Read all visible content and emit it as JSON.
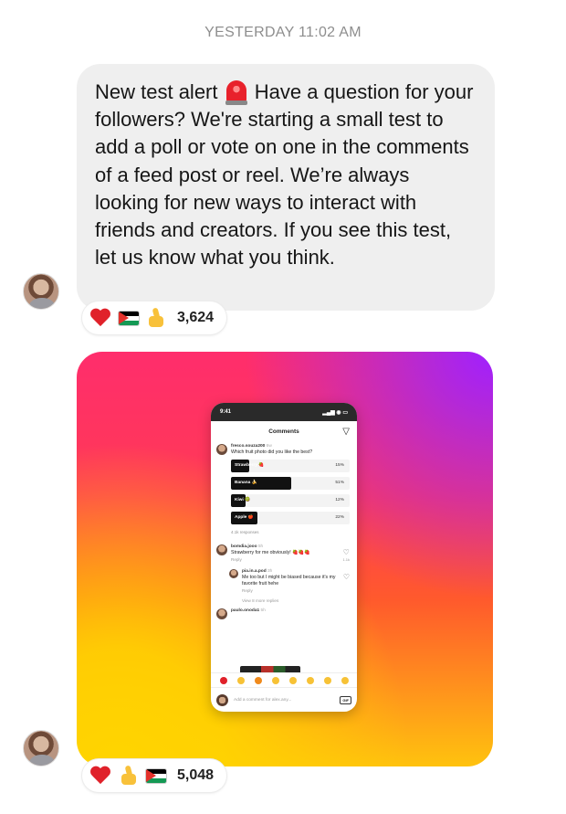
{
  "timestamp": "YESTERDAY 11:02 AM",
  "message": {
    "line1_before": "New test alert",
    "line1_after": "Have a question for",
    "rest": "your followers? We're starting a small test to add a poll or vote on one in the comments of a feed post or reel. We’re always looking for new ways to interact with friends and creators. If you see this test, let us know what you think."
  },
  "reactions": [
    {
      "icons": [
        "red-heart-icon",
        "palestine-flag-icon",
        "thumbs-up-icon"
      ],
      "count": "3,624"
    },
    {
      "icons": [
        "red-heart-icon",
        "thumbs-up-icon",
        "palestine-flag-icon"
      ],
      "count": "5,048"
    }
  ],
  "colors": {
    "bubble": "#efefef",
    "timestamp": "#8e8e8e",
    "gradient_top_right": "#a020ff",
    "gradient_mid": "#ff3a55",
    "gradient_bottom": "#ffc20e"
  },
  "phone": {
    "status_time": "9:41",
    "header_title": "Comments",
    "comment1": {
      "user": "fresco.souza200",
      "time": "6w",
      "text": "Which fruit photo did you like the best?"
    },
    "poll": [
      {
        "label": "Strawberry 🍓",
        "percent": 15
      },
      {
        "label": "Banana 🍌",
        "percent": 51
      },
      {
        "label": "Kiwi 🥝",
        "percent": 12
      },
      {
        "label": "Apple 🍎",
        "percent": 22
      }
    ],
    "poll_pct_labels": [
      "15%",
      "51%",
      "12%",
      "22%"
    ],
    "responses": "4.1k responses",
    "comment2": {
      "user": "bomdia.jooo",
      "time": "5h",
      "text": "Strawberry for me obviously! 🍓🍓🍓",
      "reply": "Reply",
      "likes": "1.1k"
    },
    "comment3": {
      "user": "pia.in.a.pod",
      "time": "3h",
      "text": "Me too but I might be biased because it's my favorite fruit hehe",
      "reply": "Reply"
    },
    "more_replies": "View 8 more replies",
    "comment4": {
      "user": "paulo.onoda1",
      "time": "5h"
    },
    "input_placeholder": "Add a comment for alex.any...",
    "gif_label": "GIF"
  }
}
